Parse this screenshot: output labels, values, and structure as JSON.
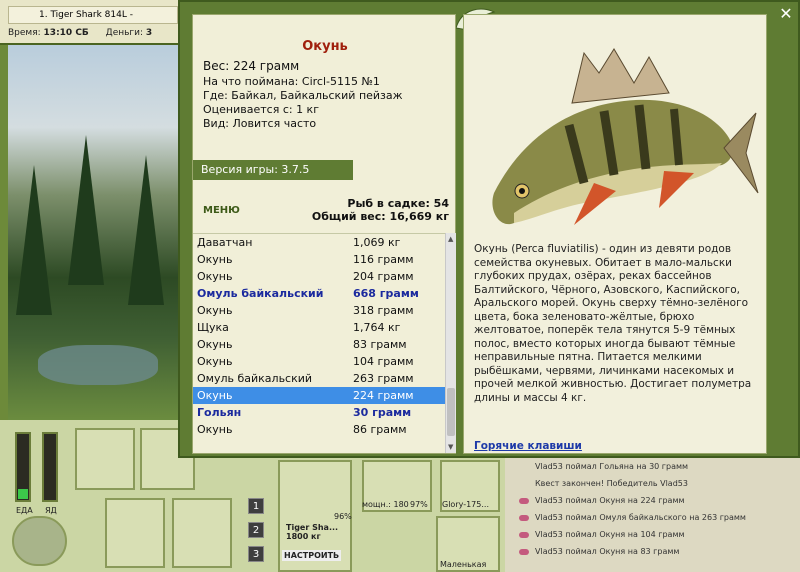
{
  "background": {
    "tab_title": "1. Tiger Shark 814L -",
    "time_label": "Время:",
    "time_value": "13:10 СБ",
    "money_label": "Деньги:",
    "money_value": "3",
    "food_label": "ЕДА",
    "poison_label": "ЯД",
    "rod_name": "Tiger Sha...",
    "rod_length": "1800 кг",
    "rod_percent": "96%",
    "setup_button": "НАСТРОИТЬ",
    "reel_label": "мощн.: 180",
    "reel_percent": "97%",
    "line_label": "Glory-175...",
    "lure_label": "Маленькая",
    "page_buttons": [
      "1",
      "2",
      "3"
    ],
    "chat": [
      "Vlad53 поймал Гольяна на 30 грамм",
      "Квест закончен! Победитель Vlad53",
      "Vlad53 поймал Окуня на 224 грамм",
      "Vlad53 поймал Омуля байкальского на 263 грамм",
      "Vlad53 поймал Окуня на 104 грамм",
      "Vlad53 поймал Окуня на 83 грамм"
    ],
    "food_level": 0.15,
    "poison_level": 0
  },
  "panel": {
    "fish_name": "Окунь",
    "weight": "Вес: 224 грамм",
    "bait": "На что поймана: Circl-5115 №1",
    "location": "Где: Байкал, Байкальский пейзаж",
    "value": "Оценивается с: 1 кг",
    "kind": "Вид: Ловится часто",
    "version": "Версия игры: 3.7.5",
    "menu": "МЕНЮ",
    "net_count": "Рыб в садке: 54",
    "net_weight": "Общий вес: 16,669 кг",
    "catches": [
      {
        "name": "Даватчан",
        "weight": "1,069 кг",
        "hl": false,
        "sel": false
      },
      {
        "name": "Окунь",
        "weight": "116 грамм",
        "hl": false,
        "sel": false
      },
      {
        "name": "Окунь",
        "weight": "204 грамм",
        "hl": false,
        "sel": false
      },
      {
        "name": "Омуль байкальский",
        "weight": "668 грамм",
        "hl": true,
        "sel": false
      },
      {
        "name": "Окунь",
        "weight": "318 грамм",
        "hl": false,
        "sel": false
      },
      {
        "name": "Щука",
        "weight": "1,764 кг",
        "hl": false,
        "sel": false
      },
      {
        "name": "Окунь",
        "weight": "83 грамм",
        "hl": false,
        "sel": false
      },
      {
        "name": "Окунь",
        "weight": "104 грамм",
        "hl": false,
        "sel": false
      },
      {
        "name": "Омуль байкальский",
        "weight": "263 грамм",
        "hl": false,
        "sel": false
      },
      {
        "name": "Окунь",
        "weight": "224 грамм",
        "hl": false,
        "sel": true
      },
      {
        "name": "Гольян",
        "weight": "30 грамм",
        "hl": true,
        "sel": false
      },
      {
        "name": "Окунь",
        "weight": "86 грамм",
        "hl": false,
        "sel": false
      }
    ],
    "description": "Окунь (Perca fluviatilis) - один из девяти родов семейства окуневых. Обитает в мало-мальски глубоких прудах, озёрах, реках бассейнов Балтийского, Чёрного, Азовского, Каспийского, Аральского морей. Окунь сверху тёмно-зелёного цвета, бока зеленовато-жёлтые, брюхо желтоватое, поперёк тела тянутся 5-9 тёмных полос, вместо которых иногда бывают тёмные неправильные пятна. Питается мелкими рыбёшками, червями, личинками насекомых и прочей мелкой живностью. Достигает полуметра длины и массы 4 кг.",
    "hotkeys": "Горячие клавиши",
    "close": "✕"
  }
}
